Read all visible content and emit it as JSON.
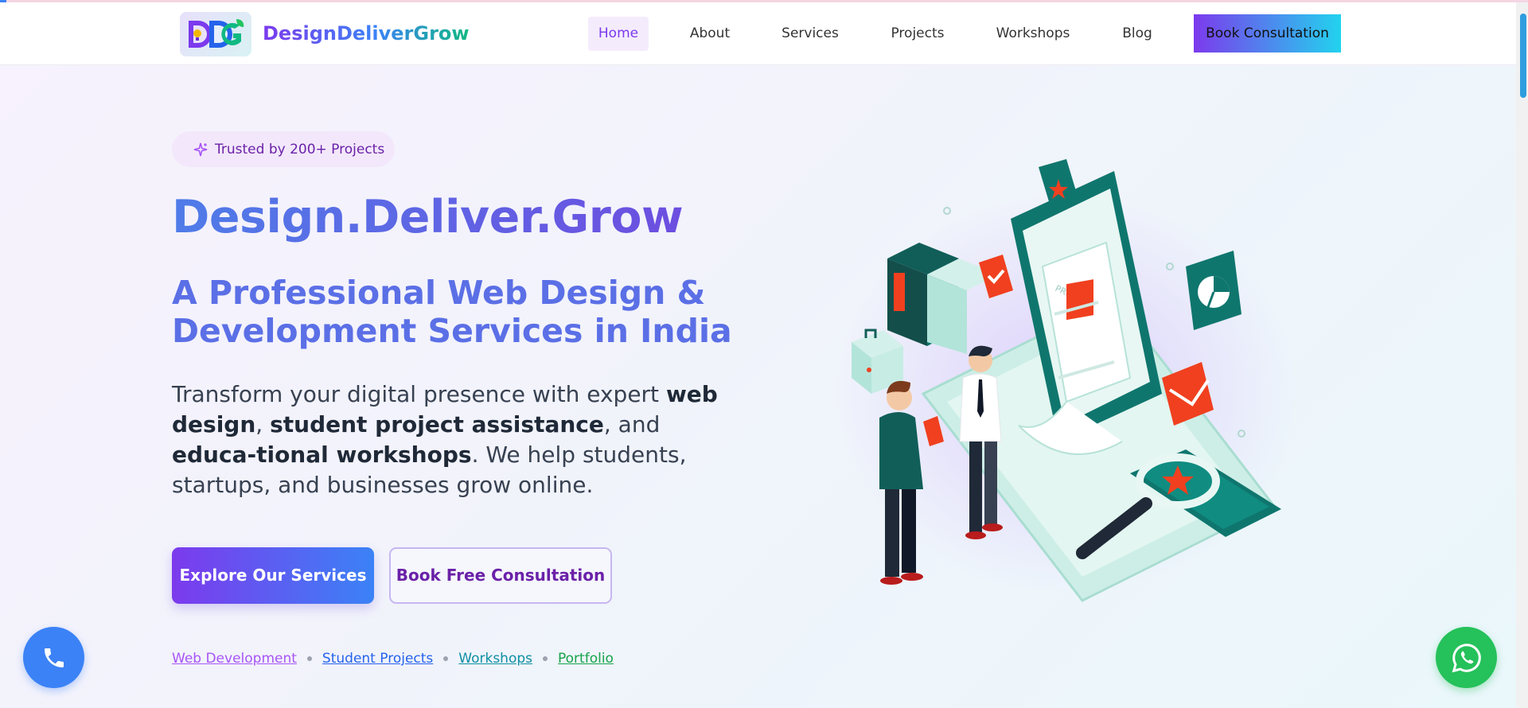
{
  "brand": {
    "name": "DesignDeliverGrow",
    "logo_text": "DDG"
  },
  "nav": {
    "items": [
      {
        "label": "Home",
        "active": true
      },
      {
        "label": "About",
        "active": false
      },
      {
        "label": "Services",
        "active": false
      },
      {
        "label": "Projects",
        "active": false
      },
      {
        "label": "Workshops",
        "active": false
      },
      {
        "label": "Blog",
        "active": false
      }
    ],
    "cta_label": "Book Consultation"
  },
  "hero": {
    "badge": "Trusted by 200+ Projects",
    "title": "Design.Deliver.Grow",
    "subtitle": "A Professional Web Design & Development Services in India",
    "description": {
      "t1": "Transform your digital presence with expert ",
      "b1": "web design",
      "t2": ", ",
      "b2": "student project assistance",
      "t3": ", and ",
      "b3": "educa-tional workshops",
      "t4": ". We help students, startups, and businesses grow online."
    },
    "primary_button": "Explore Our Services",
    "secondary_button": "Book Free Consultation",
    "quick_links": [
      {
        "label": "Web Development",
        "color": "#a855f7"
      },
      {
        "label": "Student Projects",
        "color": "#2563eb"
      },
      {
        "label": "Workshops",
        "color": "#0e8fa3"
      },
      {
        "label": "Portfolio",
        "color": "#16a34a"
      }
    ]
  },
  "illustration": {
    "doc_label": "PROFILE"
  },
  "floating": {
    "phone_icon": "phone-icon",
    "whatsapp_icon": "whatsapp-icon"
  },
  "colors": {
    "accent_purple": "#7c3aed",
    "accent_blue": "#3b82f6",
    "accent_cyan": "#22d3ee",
    "teal": "#0f766e",
    "whatsapp_green": "#25c15a"
  }
}
